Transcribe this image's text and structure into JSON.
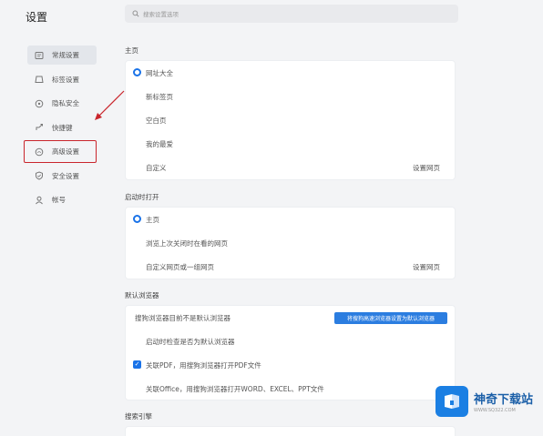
{
  "app_title": "设置",
  "search": {
    "placeholder": "搜索设置选项"
  },
  "sidebar": {
    "items": [
      {
        "label": "常规设置",
        "icon": "settings-icon"
      },
      {
        "label": "标签设置",
        "icon": "tab-icon"
      },
      {
        "label": "隐私安全",
        "icon": "privacy-icon"
      },
      {
        "label": "快捷键",
        "icon": "shortcut-icon"
      },
      {
        "label": "高级设置",
        "icon": "advanced-icon"
      },
      {
        "label": "安全设置",
        "icon": "shield-icon"
      },
      {
        "label": "帐号",
        "icon": "user-icon"
      }
    ]
  },
  "homepage": {
    "title": "主页",
    "options": [
      "网址大全",
      "新标签页",
      "空白页",
      "我的最爱",
      "自定义"
    ],
    "custom_link": "设置网页"
  },
  "startup": {
    "title": "启动时打开",
    "options": [
      "主页",
      "浏览上次关闭时在看的网页",
      "自定义网页或一组网页"
    ],
    "custom_link": "设置网页"
  },
  "default_browser": {
    "title": "默认浏览器",
    "status_text": "搜狗浏览器目前不是默认浏览器",
    "set_default_button": "将搜狗高速浏览器设置为默认浏览器",
    "startup_check": "启动时检查是否为默认浏览器",
    "pdf_label": "关联PDF，用搜狗浏览器打开PDF文件",
    "office_label": "关联Office，用搜狗浏览器打开WORD、EXCEL、PPT文件"
  },
  "search_engine": {
    "title": "搜索引擎"
  },
  "watermark": {
    "name": "神奇下载站",
    "url": "WWW.SQ322.COM"
  },
  "colors": {
    "accent": "#1a73e8",
    "button": "#2b7de0",
    "highlight": "#c9252c"
  }
}
